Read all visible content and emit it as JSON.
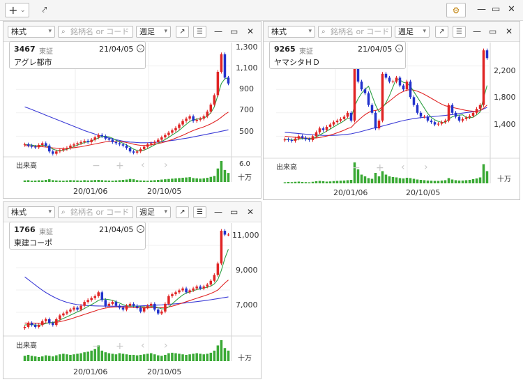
{
  "toolbar": {
    "add_label": "+",
    "dropdown_glyph": "⌄",
    "chart_glyph": "⤤",
    "gear_glyph": "⚙",
    "minimize_glyph": "—",
    "maximize_glyph": "▭",
    "close_glyph": "✕"
  },
  "panel_common": {
    "type_select": "株式",
    "search_placeholder": "銘柄名 or コード",
    "period_select": "週足",
    "volume_label": "出来高",
    "nav": [
      "−",
      "+",
      "‹",
      "›"
    ]
  },
  "panels": [
    {
      "code": "3467",
      "market": "東証",
      "date": "21/04/05",
      "name": "アグレ都市",
      "y_ticks": [
        "1,300",
        "1,100",
        "900",
        "700",
        "500"
      ],
      "volume_top": "6.0",
      "volume_unit": "十万",
      "x_ticks": [
        "20/01/06",
        "20/10/05"
      ],
      "chart_data": {
        "type": "candlestick",
        "ylim": [
          350,
          1350
        ],
        "close": [
          480,
          470,
          460,
          455,
          475,
          490,
          470,
          420,
          400,
          420,
          430,
          440,
          450,
          470,
          480,
          490,
          500,
          510,
          500,
          520,
          540,
          560,
          550,
          530,
          520,
          500,
          490,
          480,
          470,
          450,
          420,
          410,
          420,
          440,
          460,
          480,
          490,
          500,
          520,
          540,
          560,
          580,
          600,
          620,
          650,
          680,
          700,
          720,
          680,
          690,
          700,
          720,
          760,
          820,
          900,
          1100,
          1250,
          1050,
          1000
        ],
        "ma_short": [
          480,
          478,
          474,
          468,
          468,
          472,
          470,
          458,
          440,
          430,
          428,
          430,
          438,
          450,
          462,
          474,
          486,
          496,
          502,
          510,
          522,
          536,
          548,
          550,
          544,
          532,
          516,
          502,
          490,
          476,
          458,
          440,
          428,
          426,
          432,
          444,
          460,
          476,
          490,
          506,
          522,
          540,
          560,
          580,
          600,
          626,
          652,
          676,
          690,
          696,
          700,
          706,
          720,
          750,
          800,
          900,
          1000,
          1040,
          1050
        ],
        "ma_mid": [
          470,
          468,
          466,
          464,
          462,
          460,
          458,
          455,
          450,
          448,
          446,
          446,
          446,
          448,
          452,
          456,
          460,
          466,
          472,
          478,
          484,
          490,
          496,
          502,
          506,
          508,
          508,
          506,
          502,
          496,
          490,
          482,
          476,
          472,
          470,
          472,
          476,
          482,
          488,
          494,
          502,
          512,
          522,
          534,
          546,
          558,
          572,
          586,
          598,
          610,
          620,
          630,
          642,
          656,
          672,
          690,
          712,
          736,
          756
        ],
        "ma_long": [
          800,
          790,
          778,
          766,
          754,
          742,
          730,
          718,
          706,
          694,
          682,
          670,
          658,
          646,
          634,
          622,
          610,
          598,
          588,
          578,
          568,
          558,
          550,
          542,
          534,
          526,
          520,
          514,
          508,
          504,
          500,
          498,
          496,
          494,
          494,
          494,
          496,
          498,
          500,
          503,
          506,
          510,
          514,
          518,
          523,
          528,
          533,
          538,
          544,
          550,
          556,
          562,
          568,
          574,
          580,
          586,
          592,
          598,
          605
        ],
        "volume": [
          10,
          12,
          8,
          9,
          11,
          10,
          14,
          18,
          12,
          10,
          9,
          8,
          10,
          12,
          11,
          10,
          9,
          12,
          10,
          11,
          13,
          14,
          12,
          10,
          9,
          8,
          10,
          12,
          14,
          16,
          20,
          18,
          12,
          10,
          9,
          8,
          10,
          12,
          14,
          16,
          18,
          20,
          22,
          24,
          26,
          28,
          30,
          32,
          26,
          24,
          22,
          24,
          28,
          34,
          40,
          90,
          140,
          80,
          60
        ]
      }
    },
    {
      "code": "9265",
      "market": "東証",
      "date": "21/04/05",
      "name": "ヤマシタＨＤ",
      "y_ticks": [
        "2,200",
        "1,800",
        "1,400"
      ],
      "volume_top": "",
      "volume_unit": "十万",
      "x_ticks": [
        "20/01/06",
        "20/10/05"
      ],
      "chart_data": {
        "type": "candlestick",
        "ylim": [
          1000,
          2500
        ],
        "close": [
          1260,
          1250,
          1240,
          1270,
          1300,
          1280,
          1260,
          1250,
          1300,
          1350,
          1400,
          1380,
          1420,
          1450,
          1480,
          1500,
          1520,
          1550,
          1600,
          1500,
          2250,
          2000,
          1900,
          1850,
          1700,
          1600,
          1400,
          1500,
          2100,
          2050,
          2000,
          2000,
          2050,
          1950,
          1900,
          2000,
          1800,
          1700,
          1600,
          1550,
          1550,
          1500,
          1480,
          1450,
          1460,
          1480,
          1500,
          1700,
          1600,
          1550,
          1500,
          1520,
          1540,
          1560,
          1600,
          1650,
          1700,
          2400,
          2300
        ],
        "ma_short": [
          1260,
          1256,
          1250,
          1254,
          1264,
          1270,
          1270,
          1266,
          1270,
          1290,
          1316,
          1340,
          1364,
          1392,
          1420,
          1446,
          1470,
          1498,
          1530,
          1534,
          1684,
          1780,
          1850,
          1900,
          1940,
          1820,
          1700,
          1610,
          1660,
          1730,
          1820,
          1930,
          2040,
          2020,
          1990,
          1980,
          1940,
          1870,
          1800,
          1730,
          1660,
          1590,
          1540,
          1510,
          1490,
          1478,
          1474,
          1522,
          1548,
          1566,
          1570,
          1574,
          1542,
          1534,
          1544,
          1574,
          1610,
          1790,
          1950
        ],
        "ma_mid": [
          1300,
          1295,
          1290,
          1285,
          1280,
          1278,
          1276,
          1274,
          1274,
          1278,
          1284,
          1292,
          1302,
          1314,
          1328,
          1344,
          1360,
          1378,
          1398,
          1412,
          1460,
          1500,
          1540,
          1576,
          1604,
          1624,
          1630,
          1640,
          1680,
          1716,
          1750,
          1786,
          1822,
          1852,
          1874,
          1890,
          1896,
          1890,
          1876,
          1858,
          1836,
          1812,
          1786,
          1760,
          1734,
          1710,
          1690,
          1680,
          1670,
          1660,
          1650,
          1640,
          1630,
          1624,
          1620,
          1620,
          1624,
          1660,
          1700
        ],
        "ma_long": [
          1350,
          1346,
          1342,
          1338,
          1334,
          1330,
          1326,
          1322,
          1318,
          1315,
          1313,
          1311,
          1310,
          1310,
          1311,
          1313,
          1316,
          1320,
          1325,
          1330,
          1340,
          1350,
          1362,
          1374,
          1386,
          1398,
          1408,
          1418,
          1430,
          1442,
          1454,
          1466,
          1478,
          1490,
          1500,
          1510,
          1518,
          1526,
          1532,
          1538,
          1542,
          1546,
          1550,
          1554,
          1558,
          1562,
          1566,
          1572,
          1578,
          1584,
          1590,
          1596,
          1602,
          1608,
          1614,
          1620,
          1628,
          1650,
          1670
        ],
        "volume": [
          6,
          8,
          7,
          9,
          10,
          8,
          7,
          6,
          9,
          12,
          14,
          12,
          10,
          11,
          13,
          14,
          15,
          16,
          18,
          20,
          120,
          80,
          50,
          40,
          30,
          26,
          60,
          40,
          70,
          50,
          40,
          36,
          34,
          30,
          28,
          32,
          30,
          26,
          22,
          20,
          18,
          16,
          15,
          14,
          14,
          16,
          18,
          30,
          22,
          18,
          16,
          16,
          18,
          20,
          24,
          28,
          34,
          110,
          70
        ]
      }
    },
    {
      "code": "1766",
      "market": "東証",
      "date": "21/04/05",
      "name": "東建コーポ",
      "y_ticks": [
        "11,000",
        "9,000",
        "7,000"
      ],
      "volume_top": "",
      "volume_unit": "十万",
      "x_ticks": [
        "20/01/06",
        "20/10/05"
      ],
      "chart_data": {
        "type": "candlestick",
        "ylim": [
          5800,
          11600
        ],
        "close": [
          6200,
          6400,
          6300,
          6200,
          6300,
          6500,
          6600,
          6400,
          6300,
          6600,
          6800,
          6900,
          7000,
          7100,
          7200,
          7100,
          7300,
          7500,
          7600,
          7700,
          7800,
          8000,
          7600,
          7300,
          7400,
          7500,
          7300,
          7200,
          7100,
          7300,
          7400,
          7300,
          7200,
          7000,
          7200,
          7300,
          7400,
          7100,
          6900,
          7000,
          7400,
          7800,
          7900,
          8000,
          8100,
          8200,
          8000,
          8100,
          8200,
          8300,
          8200,
          8300,
          8400,
          8600,
          8900,
          9500,
          11200,
          11000,
          11000
        ],
        "ma_short": [
          6300,
          6320,
          6320,
          6300,
          6290,
          6320,
          6380,
          6420,
          6430,
          6480,
          6560,
          6640,
          6720,
          6810,
          6900,
          6980,
          7060,
          7160,
          7260,
          7360,
          7460,
          7580,
          7640,
          7640,
          7620,
          7580,
          7520,
          7440,
          7360,
          7300,
          7280,
          7280,
          7280,
          7260,
          7240,
          7240,
          7260,
          7260,
          7200,
          7140,
          7140,
          7240,
          7400,
          7560,
          7720,
          7860,
          7960,
          8020,
          8080,
          8140,
          8180,
          8220,
          8260,
          8320,
          8440,
          8660,
          9140,
          9760,
          10240
        ],
        "ma_mid": [
          6400,
          6400,
          6400,
          6395,
          6390,
          6390,
          6400,
          6410,
          6420,
          6440,
          6470,
          6510,
          6560,
          6610,
          6670,
          6730,
          6790,
          6850,
          6910,
          6970,
          7030,
          7090,
          7140,
          7180,
          7210,
          7230,
          7240,
          7240,
          7230,
          7220,
          7210,
          7205,
          7200,
          7195,
          7190,
          7190,
          7195,
          7200,
          7200,
          7200,
          7210,
          7240,
          7280,
          7330,
          7390,
          7450,
          7510,
          7570,
          7630,
          7690,
          7750,
          7810,
          7870,
          7940,
          8020,
          8120,
          8300,
          8480,
          8640
        ],
        "ma_long": [
          8800,
          8660,
          8520,
          8380,
          8240,
          8110,
          7990,
          7880,
          7780,
          7690,
          7610,
          7540,
          7480,
          7430,
          7390,
          7360,
          7340,
          7320,
          7310,
          7300,
          7295,
          7290,
          7285,
          7280,
          7278,
          7276,
          7275,
          7275,
          7276,
          7278,
          7280,
          7284,
          7288,
          7294,
          7300,
          7308,
          7316,
          7326,
          7336,
          7346,
          7358,
          7372,
          7386,
          7402,
          7418,
          7436,
          7454,
          7474,
          7494,
          7516,
          7538,
          7562,
          7586,
          7612,
          7640,
          7670,
          7700,
          7730,
          7760
        ],
        "volume": [
          20,
          24,
          20,
          18,
          16,
          18,
          22,
          20,
          18,
          22,
          26,
          28,
          26,
          24,
          26,
          28,
          30,
          34,
          36,
          40,
          46,
          60,
          40,
          34,
          30,
          28,
          26,
          30,
          28,
          26,
          24,
          24,
          22,
          24,
          26,
          28,
          30,
          26,
          22,
          20,
          24,
          30,
          32,
          30,
          28,
          26,
          24,
          26,
          28,
          30,
          28,
          26,
          28,
          32,
          40,
          60,
          80,
          50,
          40
        ]
      }
    }
  ]
}
